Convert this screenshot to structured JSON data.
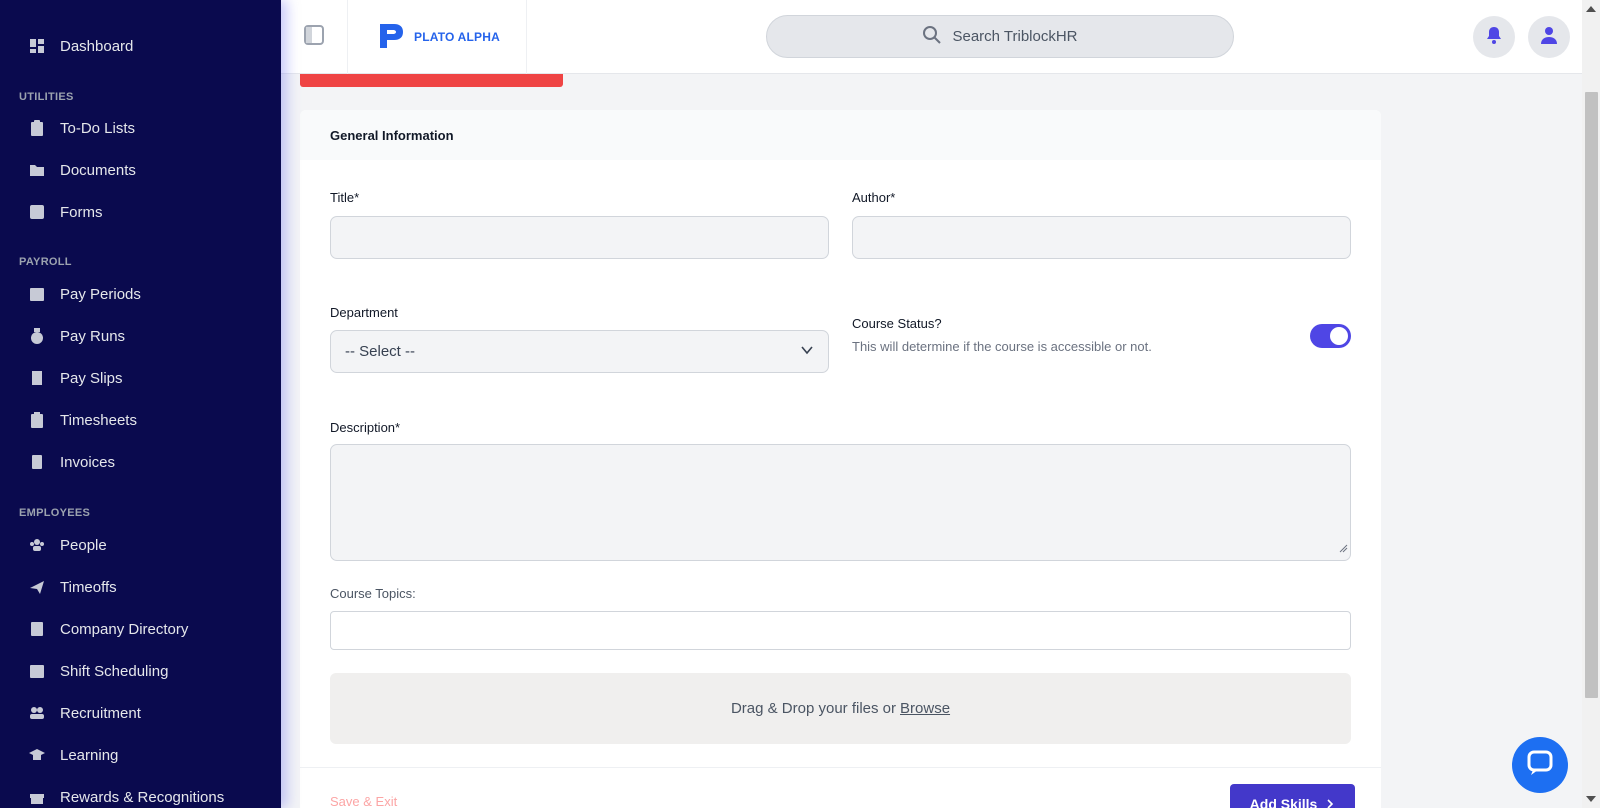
{
  "sidebar": {
    "items": [
      {
        "label": "Dashboard",
        "icon": "dashboard-icon"
      },
      {
        "label": "To-Do Lists",
        "icon": "clipboard-icon"
      },
      {
        "label": "Documents",
        "icon": "folder-icon"
      },
      {
        "label": "Forms",
        "icon": "checkbox-icon"
      },
      {
        "label": "Pay Periods",
        "icon": "calendar-icon"
      },
      {
        "label": "Pay Runs",
        "icon": "money-bag-icon"
      },
      {
        "label": "Pay Slips",
        "icon": "receipt-icon"
      },
      {
        "label": "Timesheets",
        "icon": "clipboard-list-icon"
      },
      {
        "label": "Invoices",
        "icon": "invoice-icon"
      },
      {
        "label": "People",
        "icon": "people-icon"
      },
      {
        "label": "Timeoffs",
        "icon": "plane-icon"
      },
      {
        "label": "Company Directory",
        "icon": "contact-book-icon"
      },
      {
        "label": "Shift Scheduling",
        "icon": "calendar-grid-icon"
      },
      {
        "label": "Recruitment",
        "icon": "user-group-icon"
      },
      {
        "label": "Learning",
        "icon": "graduation-cap-icon"
      },
      {
        "label": "Rewards & Recognitions",
        "icon": "gift-icon"
      }
    ],
    "sections": {
      "utilities": "UTILITIES",
      "payroll": "PAYROLL",
      "employees": "EMPLOYEES"
    }
  },
  "topbar": {
    "brand": "PLATO ALPHA",
    "search_placeholder": "Search TriblockHR"
  },
  "form": {
    "section_title": "General Information",
    "title_label": "Title*",
    "author_label": "Author*",
    "department_label": "Department",
    "department_value": "-- Select --",
    "status_title": "Course Status?",
    "status_sub": "This will determine if the course is accessible or not.",
    "status_on": true,
    "description_label": "Description*",
    "topics_label": "Course Topics:",
    "dropzone_text": "Drag & Drop your files or",
    "browse_label": "Browse",
    "save_exit_label": "Save & Exit",
    "add_skills_label": "Add Skills"
  },
  "colors": {
    "sidebar_bg": "#0a0a4e",
    "accent": "#4f46e5",
    "brand_blue": "#2563eb",
    "danger": "#ef4444"
  }
}
